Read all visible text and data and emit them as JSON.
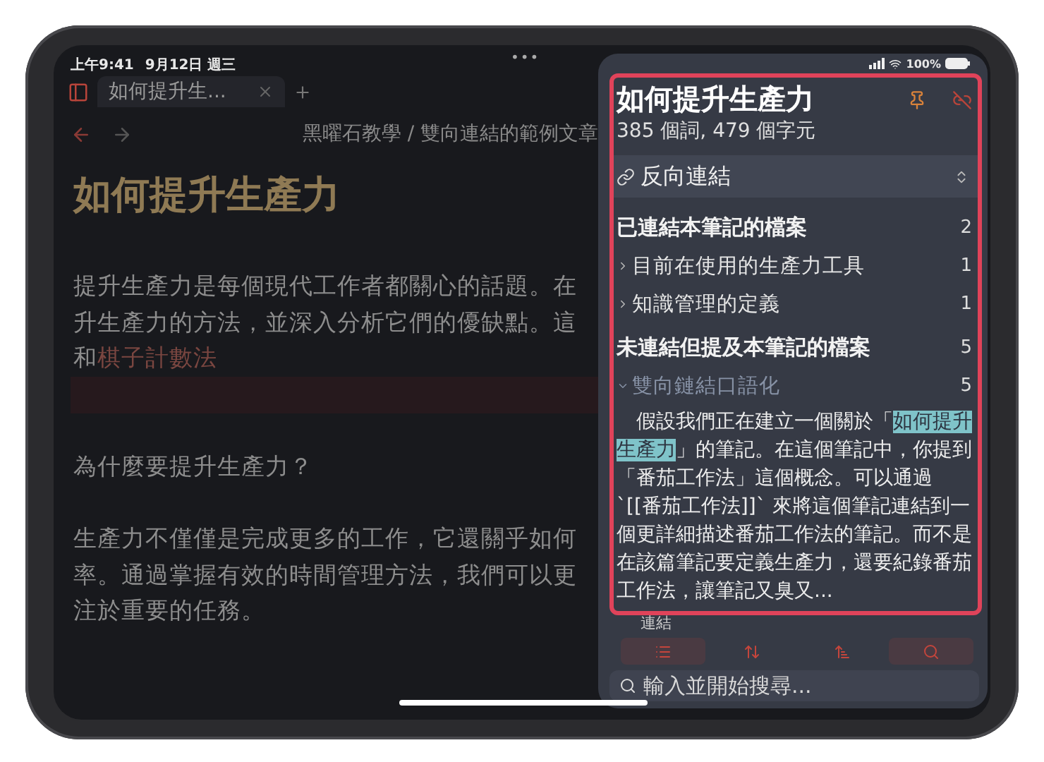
{
  "status_bar": {
    "time": "上午9:41",
    "date": "9月12日 週三",
    "battery": "100%",
    "dots": "•••"
  },
  "tab_bar": {
    "tabs": [
      {
        "title": "如何提升生...",
        "selected": true
      }
    ]
  },
  "editor": {
    "breadcrumb": "黑曜石教學 / 雙向連結的範例文章",
    "heading": "如何提升生產力",
    "lines": [
      {
        "kind": "text",
        "text": "提升生產力是每個現代工作者都關心的話題。在"
      },
      {
        "kind": "text",
        "text": "升生產力的方法，並深入分析它們的優缺點。這"
      },
      {
        "kind": "link",
        "before": "和",
        "link": "棋子計數法"
      },
      {
        "kind": "highlight"
      },
      {
        "kind": "blank"
      },
      {
        "kind": "text",
        "text": "為什麼要提升生產力？"
      },
      {
        "kind": "blank"
      },
      {
        "kind": "text",
        "text": "生產力不僅僅是完成更多的工作，它還關乎如何"
      },
      {
        "kind": "text",
        "text": "率。通過掌握有效的時間管理方法，我們可以更"
      },
      {
        "kind": "text",
        "text": "注於重要的任務。"
      }
    ]
  },
  "panel": {
    "title": "如何提升生產力",
    "stats": "385 個詞, 479 個字元",
    "section": "反向連結",
    "groups": [
      {
        "title": "已連結本筆記的檔案",
        "count": "2",
        "items": [
          {
            "title": "目前在使用的生產力工具",
            "count": "1",
            "expanded": false
          },
          {
            "title": "知識管理的定義",
            "count": "1",
            "expanded": false
          }
        ]
      },
      {
        "title": "未連結但提及本筆記的檔案",
        "count": "5",
        "items": [
          {
            "title": "雙向鏈結口語化",
            "count": "5",
            "expanded": true,
            "excerpt": {
              "before": "假設我們正在建立一個關於「",
              "match": "如何提升生產力",
              "after": "」的筆記。在這個筆記中，你提到「番茄工作法」這個概念。可以通過`[[番茄工作法]]` 來將這個筆記連結到一個更詳細描述番茄工作法的筆記。而不是在該篇筆記要定義生產力，還要紀錄番茄工作法，讓筆記又臭又..."
            }
          }
        ]
      }
    ],
    "partial_label": "連結",
    "toolbar": [
      {
        "kind": "list",
        "selected": true
      },
      {
        "kind": "expand",
        "selected": false
      },
      {
        "kind": "sort",
        "selected": false
      },
      {
        "kind": "search",
        "selected": true
      }
    ],
    "search": {
      "placeholder": "輸入並開始搜尋..."
    }
  }
}
